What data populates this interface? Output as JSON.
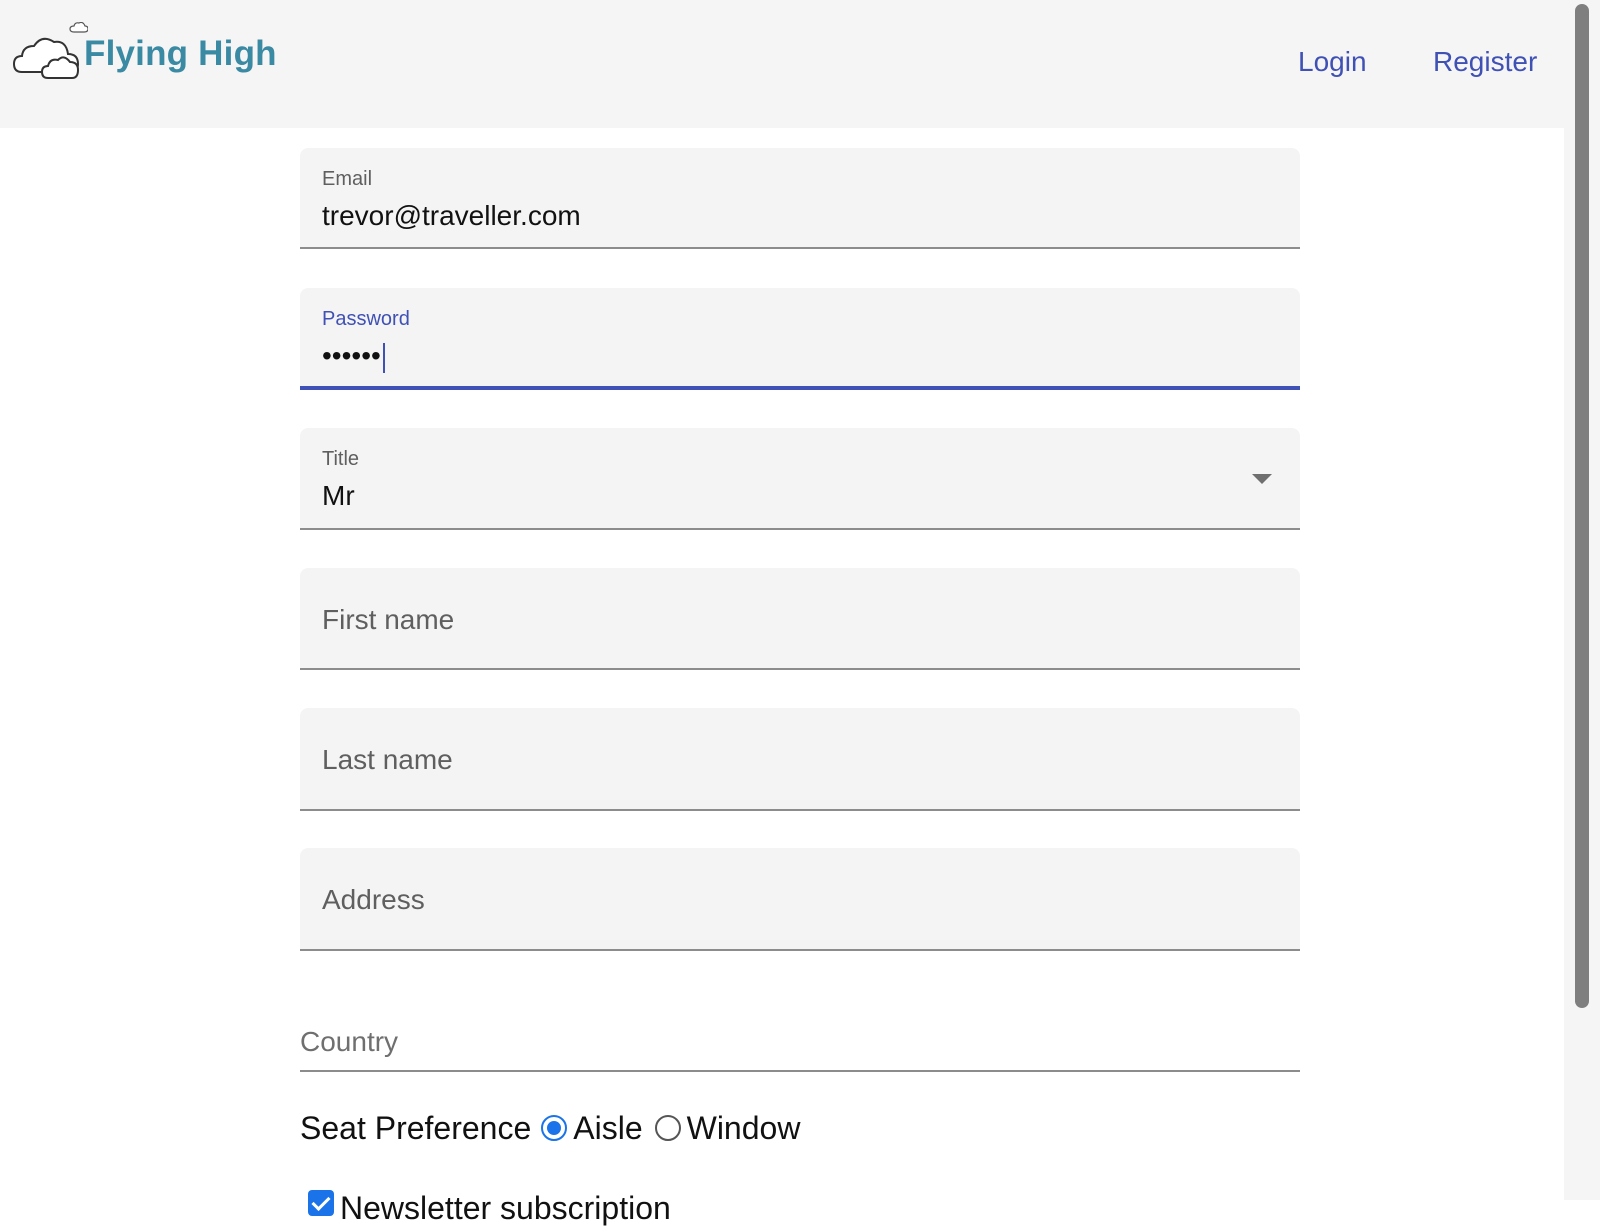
{
  "header": {
    "brand": "Flying High",
    "nav": {
      "login": "Login",
      "register": "Register"
    }
  },
  "form": {
    "email": {
      "label": "Email",
      "value": "trevor@traveller.com"
    },
    "password": {
      "label": "Password",
      "value": "••••••"
    },
    "title": {
      "label": "Title",
      "value": "Mr"
    },
    "first_name": {
      "placeholder": "First name",
      "value": ""
    },
    "last_name": {
      "placeholder": "Last name",
      "value": ""
    },
    "address": {
      "placeholder": "Address",
      "value": ""
    },
    "country": {
      "placeholder": "Country",
      "value": ""
    },
    "seat_preference": {
      "label": "Seat Preference",
      "options": [
        "Aisle",
        "Window"
      ],
      "selected": "Aisle"
    },
    "newsletter": {
      "label": "Newsletter subscription",
      "checked": true
    }
  },
  "colors": {
    "accent": "#3f51b5",
    "brand": "#3b8aa3",
    "radio_checked": "#1a73e8"
  }
}
